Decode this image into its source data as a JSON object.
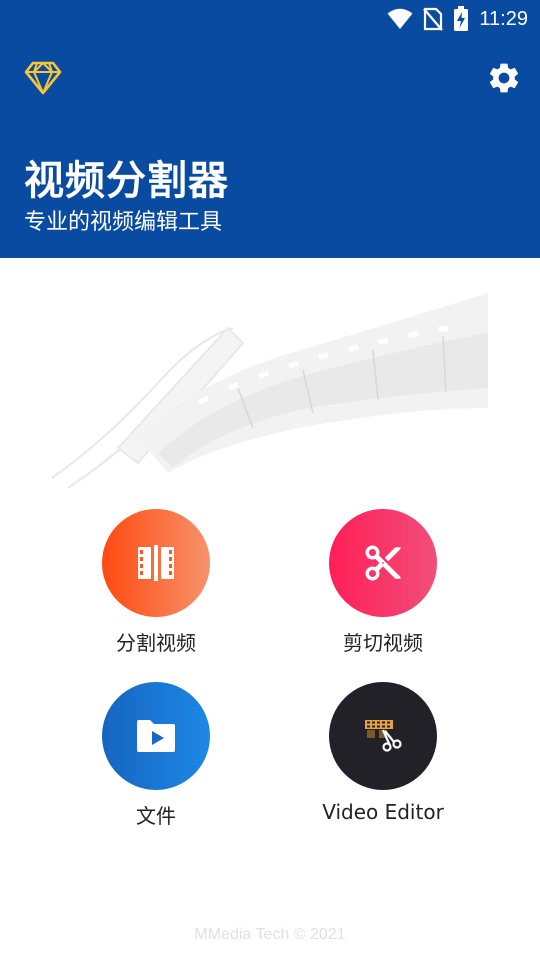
{
  "status_bar": {
    "time": "11:29",
    "icons": [
      "wifi-icon",
      "no-sim-icon",
      "battery-charging-icon"
    ]
  },
  "header": {
    "title": "视频分割器",
    "subtitle": "专业的视频编辑工具",
    "background_color": "#0A4BA2",
    "left_icon": "diamond-icon",
    "right_icon": "gear-icon"
  },
  "actions": [
    {
      "label": "分割视频",
      "icon": "split-video-icon",
      "colors": [
        "#FF4A12",
        "#F5926A"
      ]
    },
    {
      "label": "剪切视频",
      "icon": "scissors-icon",
      "colors": [
        "#FF1F57",
        "#F24E7A"
      ]
    },
    {
      "label": "文件",
      "icon": "folder-video-icon",
      "colors": [
        "#1565C0",
        "#1E88E5"
      ]
    },
    {
      "label": "Video Editor",
      "icon": "film-scissors-icon",
      "colors": [
        "#212127",
        "#212127"
      ]
    }
  ],
  "footer": {
    "text": "MMedia Tech © 2021"
  }
}
